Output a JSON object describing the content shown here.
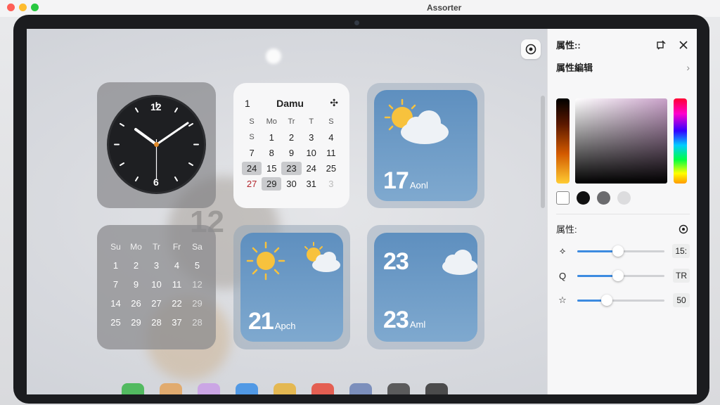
{
  "window": {
    "title": "Assorter"
  },
  "clock": {
    "label_12": "12",
    "label_6": "6"
  },
  "calendar": {
    "day": "1",
    "month": "Damu",
    "weekdays": [
      "S",
      "Mo",
      "Tr",
      "T",
      "S"
    ],
    "rows": [
      [
        "S",
        "1",
        "2",
        "3",
        "4"
      ],
      [
        "7",
        "8",
        "9",
        "10",
        "11"
      ],
      [
        "24",
        "15",
        "23",
        "24",
        "25"
      ],
      [
        "27",
        "29",
        "30",
        "31",
        "3"
      ]
    ]
  },
  "calendar2": {
    "weekdays": [
      "Su",
      "Mo",
      "Tr",
      "Fr",
      "Sa"
    ],
    "rows": [
      [
        "1",
        "2",
        "3",
        "4",
        "5"
      ],
      [
        "7",
        "9",
        "10",
        "11",
        "12"
      ],
      [
        "14",
        "26",
        "27",
        "22",
        "29"
      ],
      [
        "25",
        "29",
        "28",
        "37",
        "28"
      ]
    ]
  },
  "weather1": {
    "temp": "17",
    "label": "Aonl"
  },
  "weather2": {
    "temp": "21",
    "label": "Apch"
  },
  "weather3": {
    "temp_top": "23",
    "temp": "23",
    "label": "Aml"
  },
  "panel": {
    "header": "属性::",
    "section_title": "属性編辑",
    "section2_title": "属性:",
    "sliders": [
      {
        "icon": "speed-icon",
        "value_label": "15:",
        "value": 0.47
      },
      {
        "icon": "search-icon",
        "value_label": "TR",
        "value": 0.47
      },
      {
        "icon": "star-icon",
        "value_label": "50",
        "value": 0.34
      }
    ],
    "swatches": [
      "#ffffff",
      "#111111",
      "#6b6b6e",
      "#dcdcde"
    ]
  },
  "colors": {
    "accent": "#3d8be0",
    "weather_bg": "#5e8fbf"
  }
}
